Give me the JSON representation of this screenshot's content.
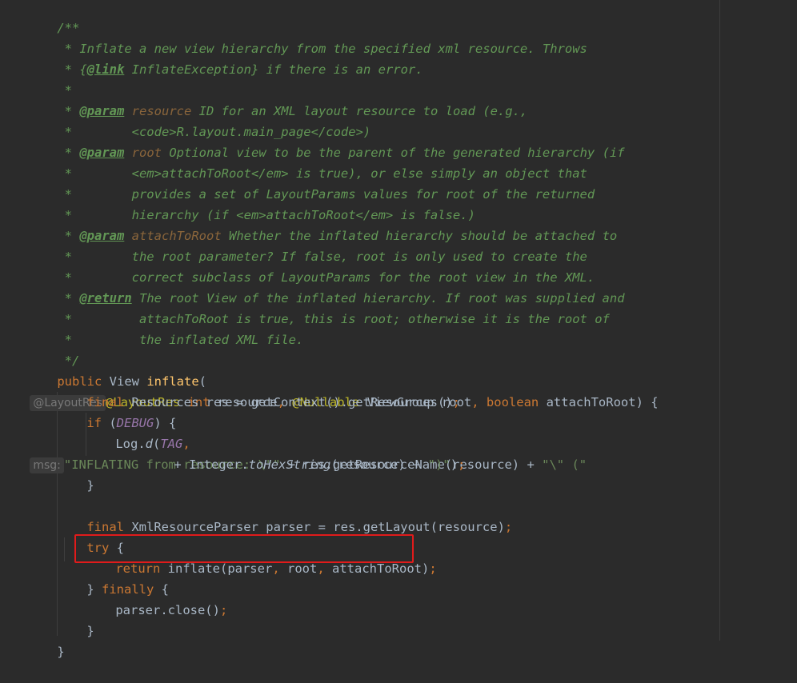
{
  "code": {
    "l1": "/**",
    "l2": " * Inflate a new view hierarchy from the specified xml resource. Throws",
    "l3a": " * {",
    "l3b": "@link",
    "l3c": " InflateException} if there is an error.",
    "l4": " *",
    "l5a": " * ",
    "l5b": "@param",
    "l5c": " ",
    "l5d": "resource",
    "l5e": " ID for an XML layout resource to load (e.g.,",
    "l6": " *        <code>R.layout.main_page</code>)",
    "l7a": " * ",
    "l7b": "@param",
    "l7c": " ",
    "l7d": "root",
    "l7e": " Optional view to be the parent of the generated hierarchy (if",
    "l8": " *        <em>attachToRoot</em> is true), or else simply an object that",
    "l9": " *        provides a set of LayoutParams values for root of the returned",
    "l10": " *        hierarchy (if <em>attachToRoot</em> is false.)",
    "l11a": " * ",
    "l11b": "@param",
    "l11c": " ",
    "l11d": "attachToRoot",
    "l11e": " Whether the inflated hierarchy should be attached to",
    "l12": " *        the root parameter? If false, root is only used to create the",
    "l13": " *        correct subclass of LayoutParams for the root view in the XML.",
    "l14a": " * ",
    "l14b": "@return",
    "l14c": " The root View of the inflated hierarchy. If root was supplied and",
    "l15": " *         attachToRoot is true, this is root; otherwise it is the root of",
    "l16": " *         the inflated XML file.",
    "l17": " */",
    "l18": {
      "public": "public",
      "type": " View ",
      "name": "inflate",
      "open": "(",
      "hint": "@LayoutRes",
      "ann1": "@LayoutRes",
      "int": " int",
      "p1": " resource",
      "comma1": ",",
      "ann2": " @Nullable",
      "p2": " ViewGroup root",
      "comma2": ",",
      "bool": " boolean",
      "p3": " attachToRoot) {"
    },
    "l19": {
      "final": "final",
      "rest": " Resources res = getContext().getResources()",
      "semi": ";"
    },
    "l20": {
      "if": "if",
      "open": " (",
      "debug": "DEBUG",
      "close": ") {"
    },
    "l21": {
      "log": "Log.",
      "d": "d",
      "open": "(",
      "tag": "TAG",
      "comma": ",",
      "hint": "msg:",
      "str1": "\"INFLATING from resource: \\\"\"",
      "mid": " + res.getResourceName(resource) + ",
      "str2": "\"\\\" (\""
    },
    "l22": {
      "plus": "+ Integer.",
      "hex": "toHexString",
      "args": "(resource) + ",
      "str": "\")\"",
      "end": ")",
      "semi": ";"
    },
    "l23": "}",
    "l25": {
      "final": "final",
      "rest": " XmlResourceParser parser = res.getLayout(resource)",
      "semi": ";"
    },
    "l26": {
      "try": "try",
      "rest": " {"
    },
    "l27": {
      "return": "return",
      "call": " inflate(parser",
      "c1": ",",
      "root": " root",
      "c2": ",",
      "attach": " attachToRoot)",
      "semi": ";"
    },
    "l28": {
      "close": "} ",
      "finally": "finally",
      "rest": " {"
    },
    "l29": {
      "call": "parser.close()",
      "semi": ";"
    },
    "l30": "}",
    "l31": "}"
  }
}
